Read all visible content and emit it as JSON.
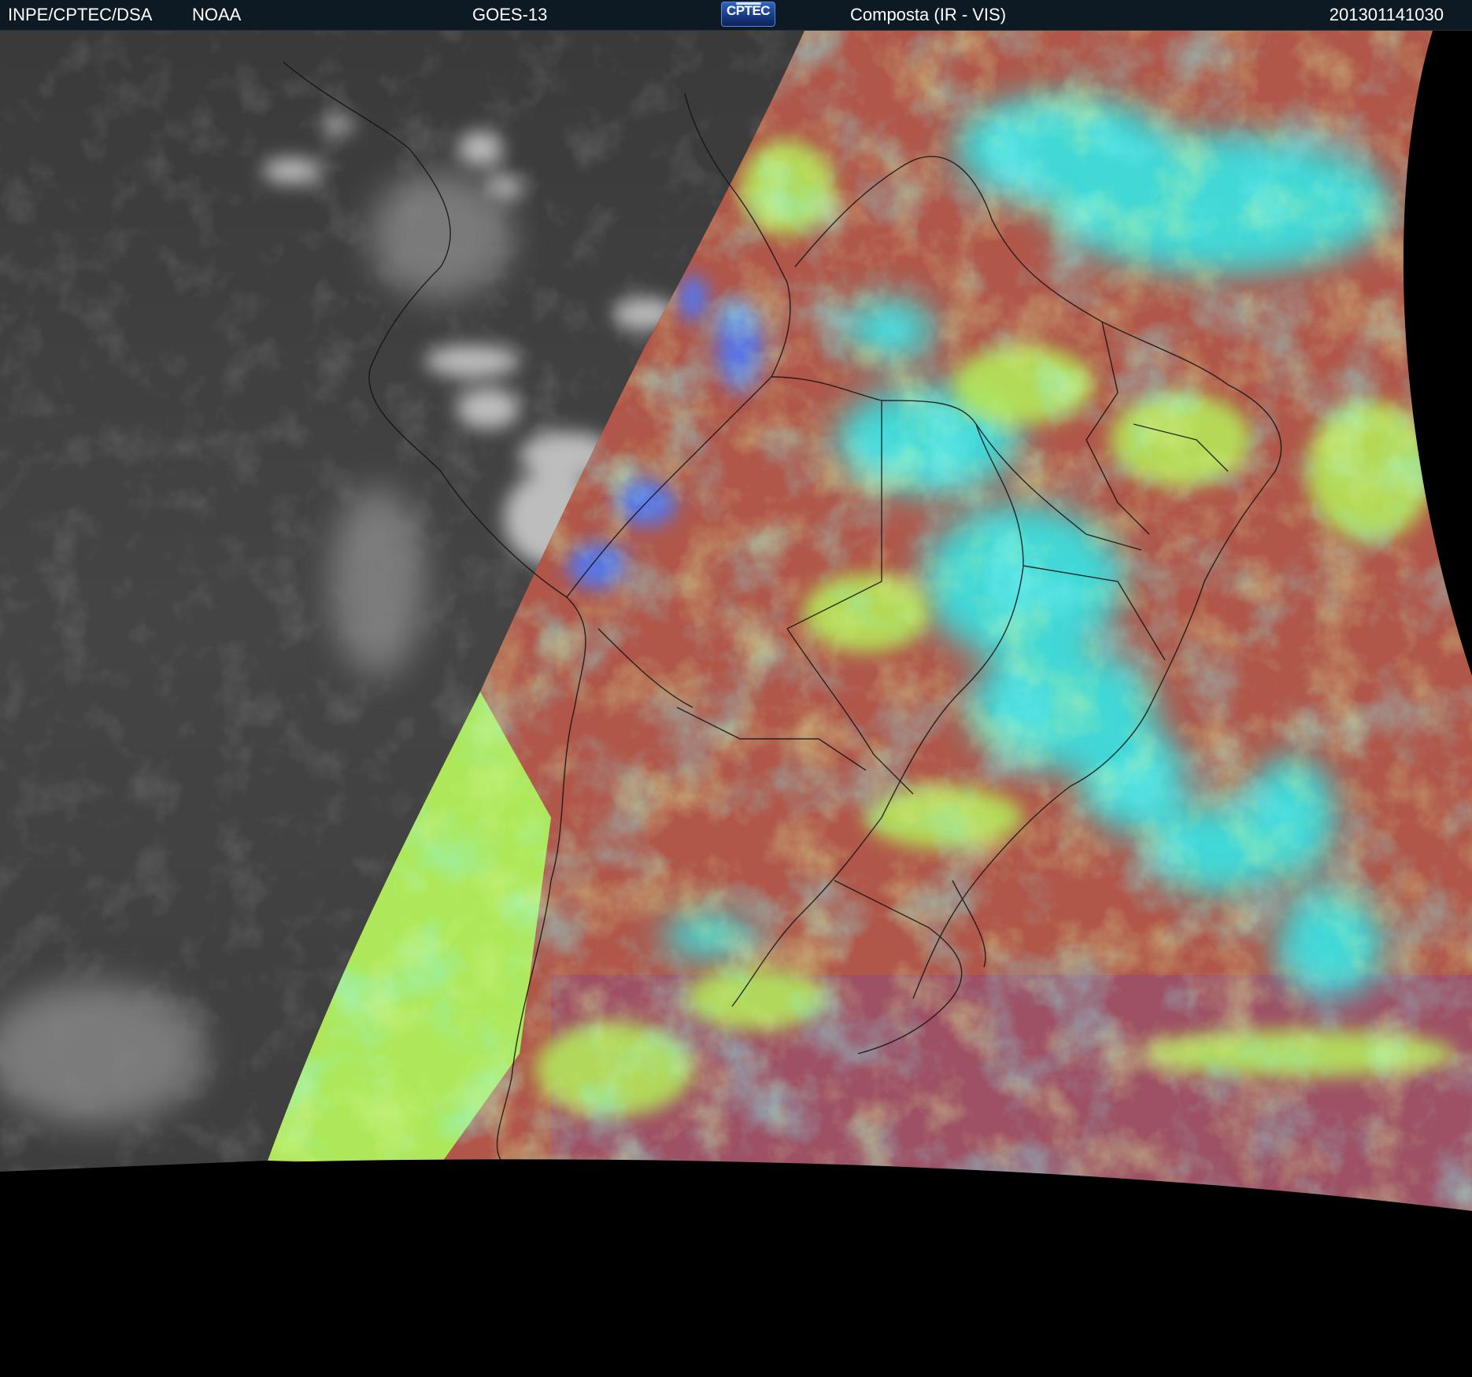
{
  "header": {
    "organization": "INPE/CPTEC/DSA",
    "agency": "NOAA",
    "satellite": "GOES-13",
    "logo_text": "CPTEC",
    "product": "Composta (IR - VIS)",
    "timestamp": "201301141030"
  },
  "colors": {
    "night_ir": "#474747",
    "land_warm": "#b05a48",
    "cloud_cyan": "#35e6e6",
    "cloud_green": "#b6f05a",
    "high_cloud_blue": "#4c7cff",
    "offdisk": "#000000",
    "header_bg": "#0d1a24"
  }
}
